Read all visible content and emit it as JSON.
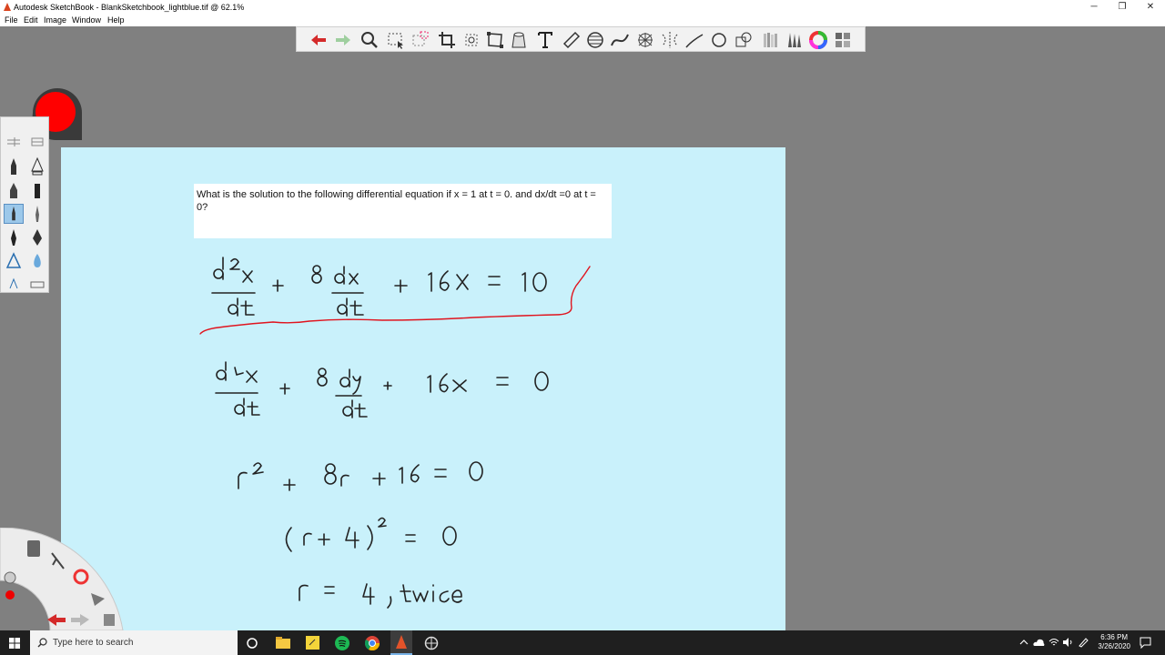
{
  "window": {
    "title": "Autodesk SketchBook - BlankSketchbook_lightblue.tif @ 62.1%",
    "minimize_glyph": "─",
    "restore_glyph": "❐",
    "close_glyph": "✕"
  },
  "menu": [
    "File",
    "Edit",
    "Image",
    "Window",
    "Help"
  ],
  "toolbar": {
    "icons": [
      "undo-icon",
      "redo-icon",
      "zoom-icon",
      "select-icon",
      "lasso-select-icon",
      "crop-icon",
      "transform-icon",
      "distort-icon",
      "fill-icon",
      "text-icon",
      "ruler-icon",
      "ellipse-guide-icon",
      "french-curve-icon",
      "perspective-icon",
      "symmetry-icon",
      "line-icon",
      "circle-icon",
      "shape-icon",
      "copic-library-icon",
      "brush-library-icon",
      "color-wheel-icon",
      "layers-icon"
    ]
  },
  "canvas": {
    "background": "#c9f1fb",
    "question": "What is the solution to the following differential equation if x = 1 at t = 0. and dx/dt =0 at t = 0?"
  },
  "taskbar": {
    "search_placeholder": "Type here to search",
    "time": "6:36 PM",
    "date": "3/26/2020"
  },
  "colors": {
    "ink": "#222222",
    "annotation": "#e0141e",
    "puck": "#ff0000"
  }
}
